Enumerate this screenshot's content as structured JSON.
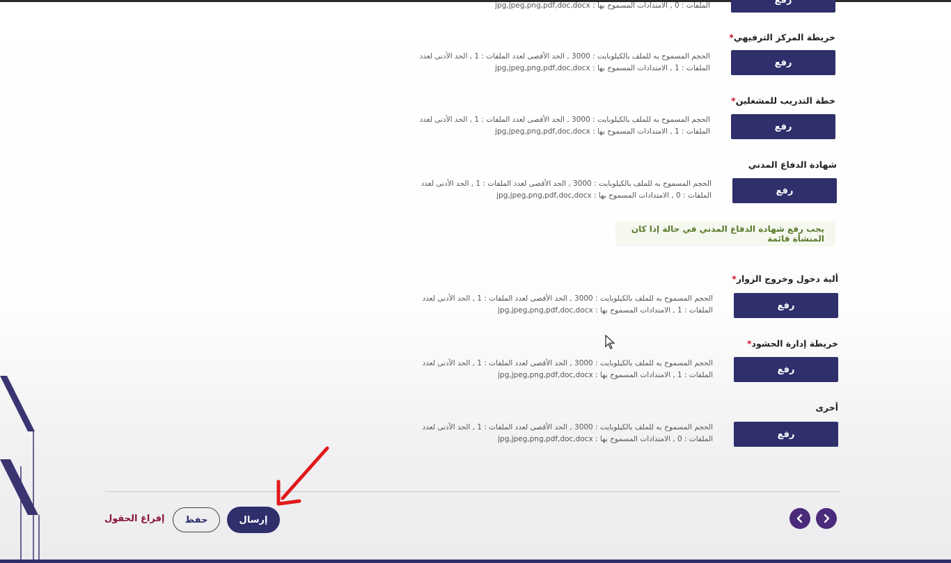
{
  "upload_button_label": "رفع",
  "first_row_partial_text": "الملفات : 0 , الامتدادات المسموح بها : jpg,jpeg,png,pdf,doc,docx",
  "fields": [
    {
      "label": "خريطة المركز الترفيهي",
      "required": true,
      "line1": "الحجم المسموح به للملف بالكيلوبايت : 3000 , الحد الأقصى لعدد الملفات : 1 , الحد الأدنى لعدد",
      "line2": "الملفات : 1 , الامتدادات المسموح بها : jpg,jpeg,png,pdf,doc,docx"
    },
    {
      "label": "خطة التدريب للمشغلين",
      "required": true,
      "line1": "الحجم المسموح به للملف بالكيلوبايت : 3000 , الحد الأقصى لعدد الملفات : 1 , الحد الأدنى لعدد",
      "line2": "الملفات : 1 , الامتدادات المسموح بها : jpg,jpeg,png,pdf,doc,docx"
    },
    {
      "label": "شهادة الدفاع المدني",
      "required": false,
      "line1": "الحجم المسموح به للملف بالكيلوبايت : 3000 , الحد الأقصى لعدد الملفات : 1 , الحد الأدنى لعدد",
      "line2": "الملفات : 0 , الامتدادات المسموح بها : jpg,jpeg,png,pdf,doc,docx"
    },
    {
      "label": "ألية دخول وخروج الزوار",
      "required": true,
      "line1": "الحجم المسموح به للملف بالكيلوبايت : 3000 , الحد الأقصى لعدد الملفات : 1 , الحد الأدنى لعدد",
      "line2": "الملفات : 1 , الامتدادات المسموح بها : jpg,jpeg,png,pdf,doc,docx"
    },
    {
      "label": "خريطة إدارة الحشود",
      "required": true,
      "line1": "الحجم المسموح به للملف بالكيلوبايت : 3000 , الحد الأقصى لعدد الملفات : 1 , الحد الأدنى لعدد",
      "line2": "الملفات : 1 , الامتدادات المسموح بها : jpg,jpeg,png,pdf,doc,docx"
    },
    {
      "label": "أخرى",
      "required": false,
      "line1": "الحجم المسموح به للملف بالكيلوبايت : 3000 , الحد الأقصى لعدد الملفات : 1 , الحد الأدنى لعدد",
      "line2": "الملفات : 0 , الامتدادات المسموح بها : jpg,jpeg,png,pdf,doc,docx"
    }
  ],
  "civil_defense_note": "يجب رفع شهادة الدفاع المدني في حالة إذا كان المنشأة قائمة",
  "actions": {
    "send_label": "إرسال",
    "save_label": "حفظ",
    "clear_label": "إفراغ الحقول"
  },
  "colors": {
    "primary": "#2e2f6b",
    "required": "#c8102e",
    "note_text": "#5a7a2c",
    "clear_link": "#8a1538",
    "nav_button": "#4a2a7a"
  },
  "icons": {
    "prev": "chevron-left-icon",
    "next": "chevron-right-icon",
    "annotation": "red-arrow-icon"
  }
}
